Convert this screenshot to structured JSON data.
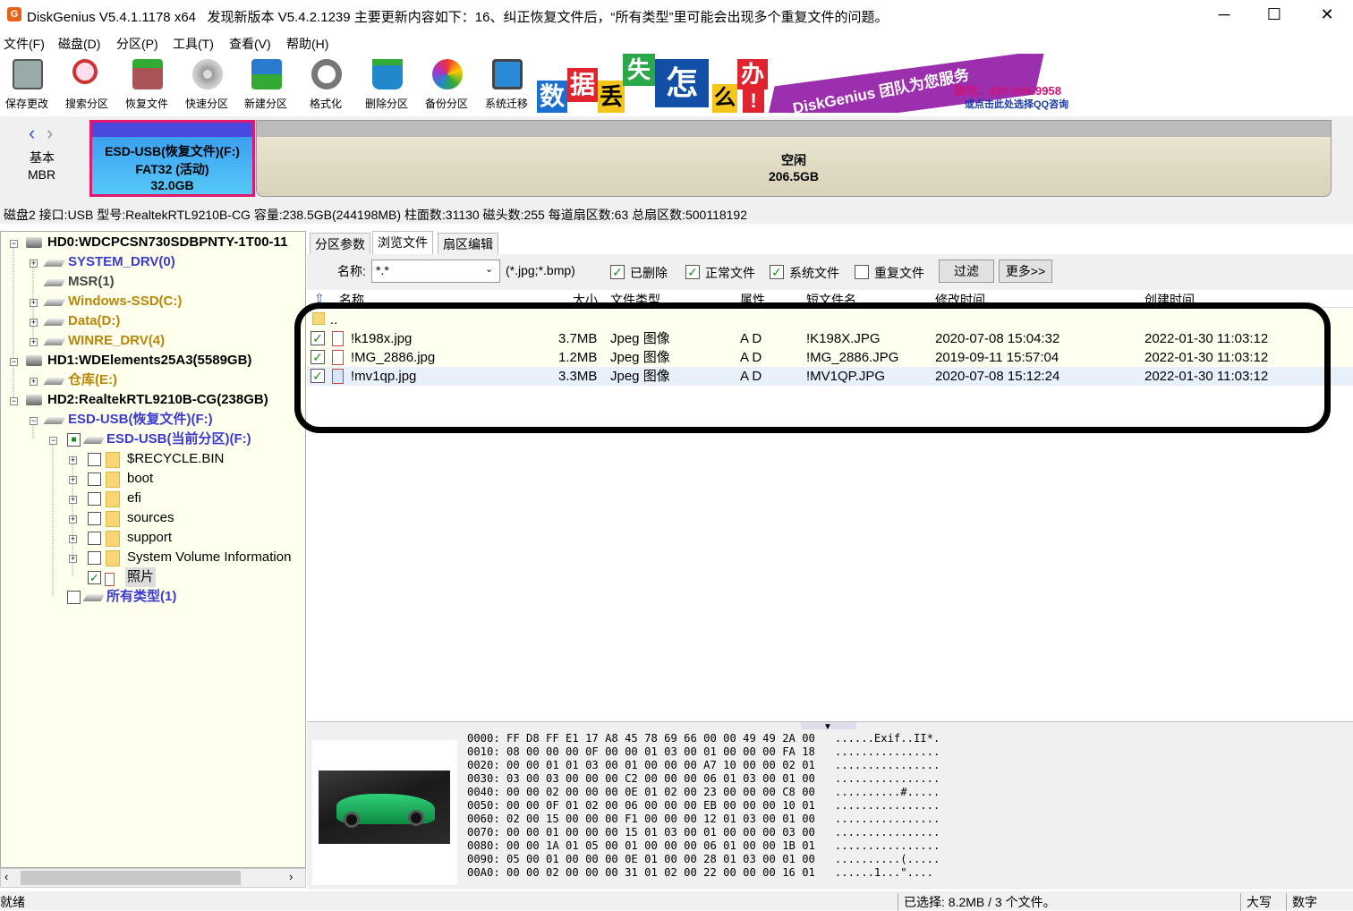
{
  "window": {
    "title": "DiskGenius V5.4.1.1178 x64",
    "update_notice": "发现新版本 V5.4.2.1239   主要更新内容如下：16、纠正恢复文件后，“所有类型”里可能会出现多个重复文件的问题。",
    "app_icon_glyph": "G"
  },
  "menu": [
    "文件(F)",
    "磁盘(D)",
    "分区(P)",
    "工具(T)",
    "查看(V)",
    "帮助(H)"
  ],
  "toolbar": [
    "保存更改",
    "搜索分区",
    "恢复文件",
    "快速分区",
    "新建分区",
    "格式化",
    "删除分区",
    "备份分区",
    "系统迁移"
  ],
  "banner": {
    "chars": [
      "数",
      "据",
      "丢",
      "失",
      "怎",
      "么",
      "办",
      "!"
    ],
    "slogan": "DiskGenius 团队为您服务",
    "phone": "致电：400-008-9958",
    "qq": "或点击此处选择QQ咨询"
  },
  "diskmap": {
    "nav_left": "‹",
    "nav_right": "›",
    "disk_type_1": "基本",
    "disk_type_2": "MBR",
    "partition_name": "ESD-USB(恢复文件)(F:)",
    "partition_fs": "FAT32 (活动)",
    "partition_size": "32.0GB",
    "free_label": "空闲",
    "free_size": "206.5GB"
  },
  "disk_info": "磁盘2 接口:USB  型号:RealtekRTL9210B-CG  容量:238.5GB(244198MB)  柱面数:31130  磁头数:255  每道扇区数:63  总扇区数:500118192",
  "tree": {
    "hd0": "HD0:WDCPCSN730SDBPNTY-1T00-11",
    "hd0_parts": [
      "SYSTEM_DRV(0)",
      "MSR(1)",
      "Windows-SSD(C:)",
      "Data(D:)",
      "WINRE_DRV(4)"
    ],
    "hd1": "HD1:WDElements25A3(5589GB)",
    "hd1_parts": [
      "仓库(E:)"
    ],
    "hd2": "HD2:RealtekRTL9210B-CG(238GB)",
    "hd2_part": "ESD-USB(恢复文件)(F:)",
    "current": "ESD-USB(当前分区)(F:)",
    "folders": [
      "$RECYCLE.BIN",
      "boot",
      "efi",
      "sources",
      "support",
      "System Volume Information"
    ],
    "photos": "照片",
    "all_types": "所有类型(1)"
  },
  "tabs": [
    "分区参数",
    "浏览文件",
    "扇区编辑"
  ],
  "filter": {
    "name_label": "名称:",
    "name_value": "*.*",
    "pattern_hint": "(*.jpg;*.bmp)",
    "deleted": "已删除",
    "normal": "正常文件",
    "system": "系统文件",
    "duplicate": "重复文件",
    "filter_btn": "过滤",
    "more_btn": "更多>>"
  },
  "columns": [
    "名称",
    "大小",
    "文件类型",
    "属性",
    "短文件名",
    "修改时间",
    "创建时间"
  ],
  "parent_dir": "..",
  "files": [
    {
      "name": "!k198x.jpg",
      "size": "3.7MB",
      "type": "Jpeg 图像",
      "attr": "A D",
      "short": "!K198X.JPG",
      "modified": "2020-07-08 15:04:32",
      "created": "2022-01-30 11:03:12"
    },
    {
      "name": "!MG_2886.jpg",
      "size": "1.2MB",
      "type": "Jpeg 图像",
      "attr": "A D",
      "short": "!MG_2886.JPG",
      "modified": "2019-09-11 15:57:04",
      "created": "2022-01-30 11:03:12"
    },
    {
      "name": "!mv1qp.jpg",
      "size": "3.3MB",
      "type": "Jpeg 图像",
      "attr": "A D",
      "short": "!MV1QP.JPG",
      "modified": "2020-07-08 15:12:24",
      "created": "2022-01-30 11:03:12"
    }
  ],
  "hex_dump": "0000: FF D8 FF E1 17 A8 45 78 69 66 00 00 49 49 2A 00   ......Exif..II*.\n0010: 08 00 00 00 0F 00 00 01 03 00 01 00 00 00 FA 18   ................\n0020: 00 00 01 01 03 00 01 00 00 00 A7 10 00 00 02 01   ................\n0030: 03 00 03 00 00 00 C2 00 00 00 06 01 03 00 01 00   ................\n0040: 00 00 02 00 00 00 0E 01 02 00 23 00 00 00 C8 00   ..........#.....\n0050: 00 00 0F 01 02 00 06 00 00 00 EB 00 00 00 10 01   ................\n0060: 02 00 15 00 00 00 F1 00 00 00 12 01 03 00 01 00   ................\n0070: 00 00 01 00 00 00 15 01 03 00 01 00 00 00 03 00   ................\n0080: 00 00 1A 01 05 00 01 00 00 00 06 01 00 00 1B 01   ................\n0090: 05 00 01 00 00 00 0E 01 00 00 28 01 03 00 01 00   ..........(.....\n00A0: 00 00 02 00 00 00 31 01 02 00 22 00 00 00 16 01   ......1...\"....",
  "status": {
    "ready": "就绪",
    "selection": "已选择: 8.2MB / 3 个文件。",
    "caps": "大写",
    "num": "数字"
  },
  "colors": {
    "accent_blue": "#3a3ad0",
    "partition_orange": "#b8860b",
    "tree_bg": "#ffffee",
    "partition_border": "#e0186e",
    "banner_purple": "#9b2fae"
  }
}
